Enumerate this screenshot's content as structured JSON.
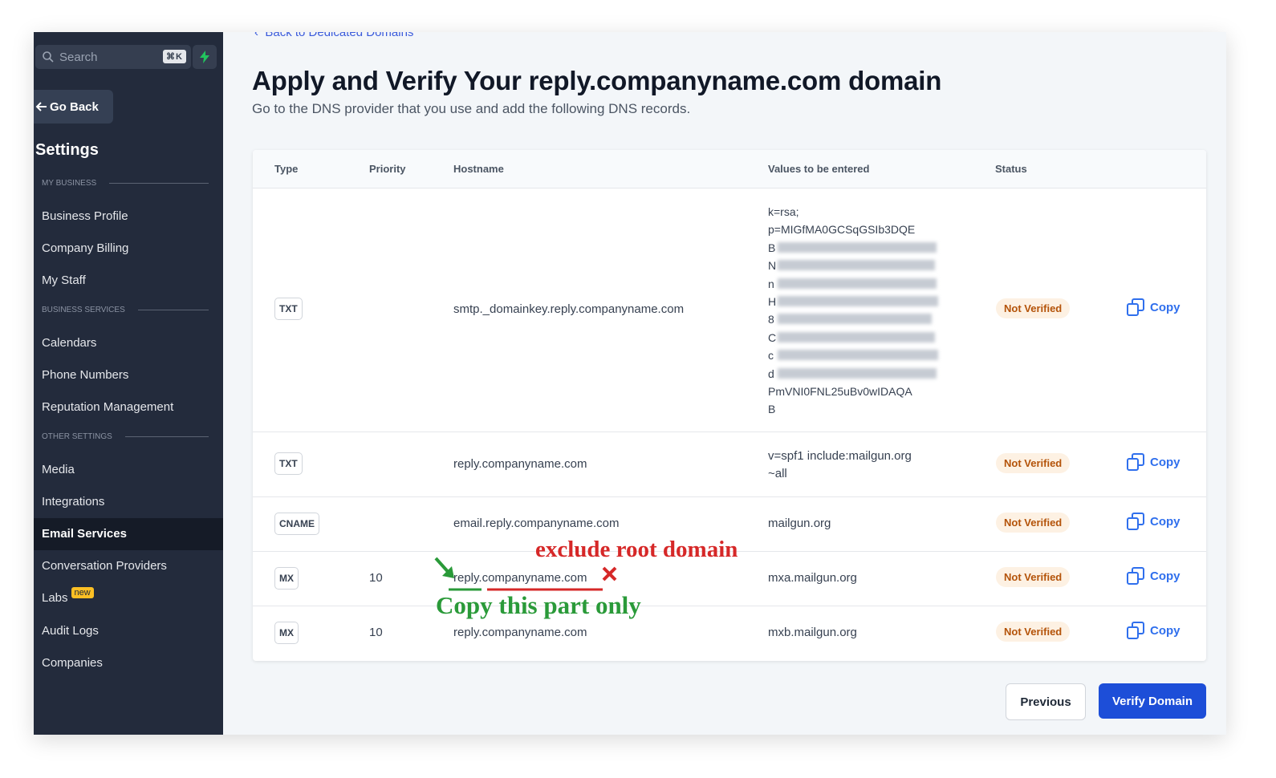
{
  "sidebar": {
    "search": {
      "placeholder": "Search",
      "shortcut": "⌘K"
    },
    "go_back": "Go Back",
    "title": "Settings",
    "sections": [
      {
        "label": "MY BUSINESS",
        "items": [
          "Business Profile",
          "Company Billing",
          "My Staff"
        ]
      },
      {
        "label": "BUSINESS SERVICES",
        "items": [
          "Calendars",
          "Phone Numbers",
          "Reputation Management"
        ]
      },
      {
        "label": "OTHER SETTINGS",
        "items": [
          "Media",
          "Integrations",
          "Email Services",
          "Conversation Providers",
          "Labs",
          "Audit Logs",
          "Companies"
        ]
      }
    ],
    "active_item": "Email Services",
    "labs_badge": "new"
  },
  "main": {
    "back_link": "Back to Dedicated Domains",
    "title": "Apply and Verify Your reply.companyname.com domain",
    "subtitle": "Go to the DNS provider that you use and add the following DNS records.",
    "table": {
      "headers": [
        "Type",
        "Priority",
        "Hostname",
        "Values to be entered",
        "Status"
      ],
      "rows": [
        {
          "type": "TXT",
          "priority": "",
          "hostname": "smtp._domainkey.reply.companyname.com",
          "value_lines": [
            "k=rsa;",
            "p=MIGfMA0GCSqGSIb3DQE",
            "B",
            "N",
            "n",
            "H",
            "8",
            "C",
            "c",
            "d",
            "PmVNI0FNL25uBv0wIDAQA",
            "B"
          ],
          "status": "Not Verified",
          "copy": "Copy"
        },
        {
          "type": "TXT",
          "priority": "",
          "hostname": "reply.companyname.com",
          "value_lines": [
            "v=spf1 include:mailgun.org",
            "~all"
          ],
          "status": "Not Verified",
          "copy": "Copy"
        },
        {
          "type": "CNAME",
          "priority": "",
          "hostname": "email.reply.companyname.com",
          "value_lines": [
            "mailgun.org"
          ],
          "status": "Not Verified",
          "copy": "Copy"
        },
        {
          "type": "MX",
          "priority": "10",
          "hostname": "reply.companyname.com",
          "value_lines": [
            "mxa.mailgun.org"
          ],
          "status": "Not Verified",
          "copy": "Copy"
        },
        {
          "type": "MX",
          "priority": "10",
          "hostname": "reply.companyname.com",
          "value_lines": [
            "mxb.mailgun.org"
          ],
          "status": "Not Verified",
          "copy": "Copy"
        }
      ]
    },
    "buttons": {
      "previous": "Previous",
      "verify": "Verify Domain"
    },
    "annotations": {
      "red": "exclude root domain",
      "green": "Copy this part only"
    }
  },
  "colors": {
    "sidebar_bg": "#232b3c",
    "accent": "#1d4ed8",
    "status_text": "#b45309",
    "annotation_red": "#d62828",
    "annotation_green": "#2a9a39"
  }
}
